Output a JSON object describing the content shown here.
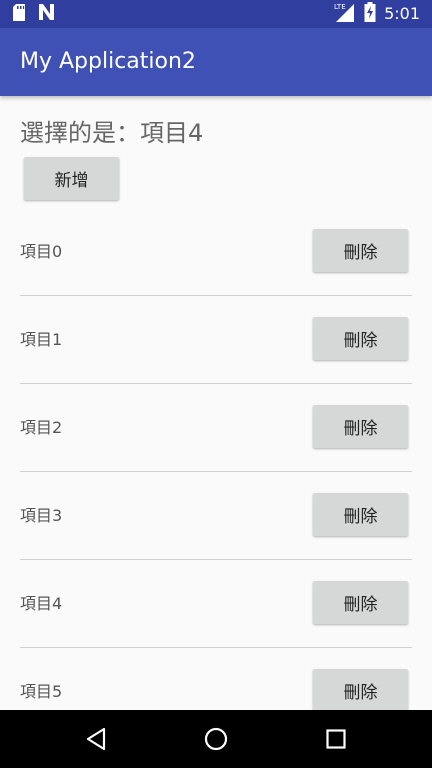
{
  "status_bar": {
    "time": "5:01",
    "network_label": "LTE",
    "icons": [
      "sd-card-icon",
      "n-notification-icon",
      "lte-signal-icon",
      "battery-charging-icon"
    ]
  },
  "app_bar": {
    "title": "My Application2"
  },
  "selection": {
    "text": "選擇的是：項目4"
  },
  "add_button": {
    "label": "新增"
  },
  "items": [
    {
      "label": "項目0",
      "button": "刪除"
    },
    {
      "label": "項目1",
      "button": "刪除"
    },
    {
      "label": "項目2",
      "button": "刪除"
    },
    {
      "label": "項目3",
      "button": "刪除"
    },
    {
      "label": "項目4",
      "button": "刪除"
    },
    {
      "label": "項目5",
      "button": "刪除"
    }
  ],
  "nav_bar": {
    "icons": [
      "back-icon",
      "home-icon",
      "recents-icon"
    ]
  },
  "colors": {
    "status_bar": "#303f9f",
    "app_bar": "#3f51b5",
    "background": "#fafafa",
    "button": "#d6d7d7"
  }
}
